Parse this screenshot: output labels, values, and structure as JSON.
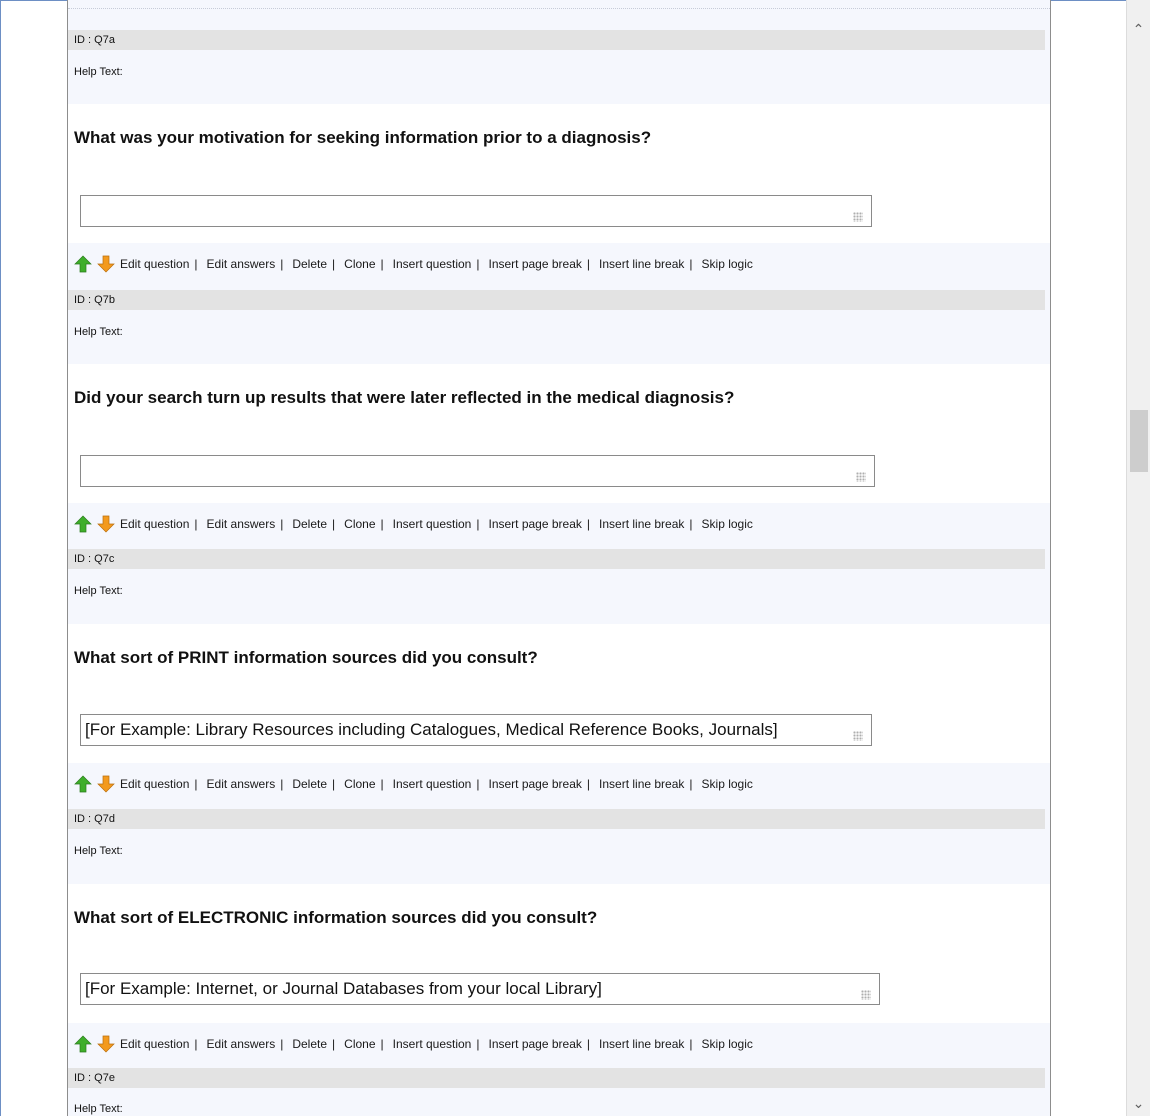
{
  "questions": [
    {
      "id_label": "ID : Q7a",
      "help_label": "Help Text:"
    },
    {
      "title": "What was your motivation for seeking information prior to a diagnosis?",
      "answer_value": "",
      "id_label": "ID : Q7b",
      "help_label": "Help Text:"
    },
    {
      "title": "Did your search turn up results that were later reflected in the medical diagnosis?",
      "answer_value": "",
      "id_label": "ID : Q7c",
      "help_label": "Help Text:"
    },
    {
      "title": "What sort of PRINT information sources did you consult?",
      "answer_value": "[For Example: Library Resources including Catalogues, Medical Reference Books, Journals]",
      "id_label": "ID : Q7d",
      "help_label": "Help Text:"
    },
    {
      "title": "What sort of ELECTRONIC information sources did you consult?",
      "answer_value": "[For Example: Internet, or Journal Databases from your local Library]",
      "id_label": "ID : Q7e",
      "help_label": "Help Text:"
    }
  ],
  "toolbar": {
    "edit_question": "Edit question",
    "edit_answers": "Edit answers",
    "delete": "Delete",
    "clone": "Clone",
    "insert_question": "Insert question",
    "insert_page_break": "Insert page break",
    "insert_line_break": "Insert line break",
    "skip_logic": "Skip logic",
    "separator": "|"
  },
  "icons": {
    "move_up": "arrow-up-icon",
    "move_down": "arrow-down-icon",
    "move_up_color": "#3fae2a",
    "move_down_color": "#f39a1e"
  }
}
